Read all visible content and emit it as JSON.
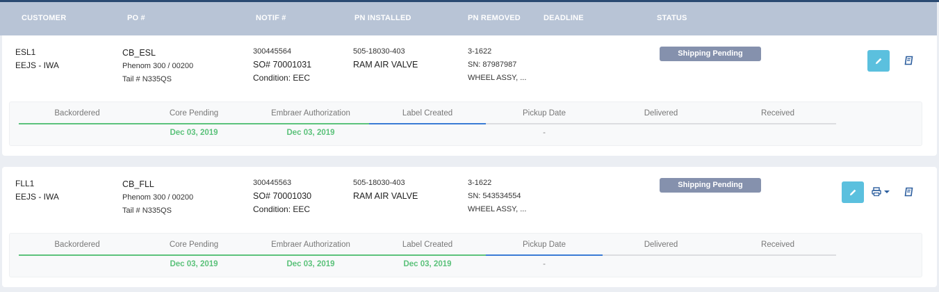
{
  "columns": [
    "CUSTOMER",
    "PO #",
    "NOTIF #",
    "PN INSTALLED",
    "PN REMOVED",
    "DEADLINE",
    "STATUS"
  ],
  "orders": [
    {
      "customer": "ESL1",
      "customer_sub": "EEJS - IWA",
      "po": "CB_ESL",
      "po_aircraft": "Phenom 300 / 00200",
      "po_tail": "Tail # N335QS",
      "notif": "300445564",
      "so": "SO# 70001031",
      "condition": "Condition: EEC",
      "pn_installed": "505-18030-403",
      "pn_installed_desc": "RAM AIR VALVE",
      "pn_removed": "3-1622",
      "sn": "SN: 87987987",
      "pn_removed_desc": "WHEEL ASSY, ...",
      "deadline": "",
      "status": "Shipping Pending",
      "steps": [
        {
          "label": "Backordered",
          "date": "",
          "state": "done"
        },
        {
          "label": "Core Pending",
          "date": "Dec 03, 2019",
          "state": "done"
        },
        {
          "label": "Embraer Authorization",
          "date": "Dec 03, 2019",
          "state": "done"
        },
        {
          "label": "Label Created",
          "date": "",
          "state": "current"
        },
        {
          "label": "Pickup Date",
          "date": "-",
          "state": "pending"
        },
        {
          "label": "Delivered",
          "date": "",
          "state": "pending"
        },
        {
          "label": "Received",
          "date": "",
          "state": "pending"
        }
      ]
    },
    {
      "customer": "FLL1",
      "customer_sub": "EEJS - IWA",
      "po": "CB_FLL",
      "po_aircraft": "Phenom 300 / 00200",
      "po_tail": "Tail # N335QS",
      "notif": "300445563",
      "so": "SO# 70001030",
      "condition": "Condition: EEC",
      "pn_installed": "505-18030-403",
      "pn_installed_desc": "RAM AIR VALVE",
      "pn_removed": "3-1622",
      "sn": "SN: 543534554",
      "pn_removed_desc": "WHEEL ASSY, ...",
      "deadline": "",
      "status": "Shipping Pending",
      "steps": [
        {
          "label": "Backordered",
          "date": "",
          "state": "done"
        },
        {
          "label": "Core Pending",
          "date": "Dec 03, 2019",
          "state": "done"
        },
        {
          "label": "Embraer Authorization",
          "date": "Dec 03, 2019",
          "state": "done"
        },
        {
          "label": "Label Created",
          "date": "Dec 03, 2019",
          "state": "done"
        },
        {
          "label": "Pickup Date",
          "date": "-",
          "state": "current"
        },
        {
          "label": "Delivered",
          "date": "",
          "state": "pending"
        },
        {
          "label": "Received",
          "date": "",
          "state": "pending"
        }
      ]
    }
  ],
  "icons": {
    "edit": "pencil-icon",
    "print": "printer-icon",
    "book": "book-icon"
  },
  "colors": {
    "header_bg": "#b8c4d6",
    "badge": "#8591ad",
    "edit_button": "#5bc0de",
    "done": "#5cc27b",
    "current": "#3a7bd5"
  }
}
